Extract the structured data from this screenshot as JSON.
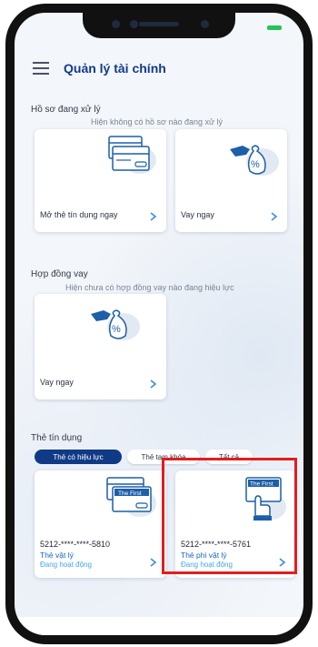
{
  "header": {
    "title": "Quản lý tài chính"
  },
  "profiles": {
    "title": "Hồ sơ đang xử lý",
    "note": "Hiện không có hồ sơ nào đang xử lý",
    "cards": [
      {
        "label": "Mở thẻ tín dụng ngay"
      },
      {
        "label": "Vay ngay"
      }
    ]
  },
  "loans": {
    "title": "Hợp đồng vay",
    "note": "Hiện chưa có hợp đồng vay nào đang hiệu lực",
    "cards": [
      {
        "label": "Vay ngay"
      }
    ]
  },
  "credit_cards": {
    "title": "Thẻ tín dụng",
    "filters": [
      "Thẻ có hiệu lực",
      "Thẻ tạm khóa",
      "Tất cả"
    ],
    "active_filter": "Thẻ có hiệu lực",
    "cards": [
      {
        "number": "5212-****-****-5810",
        "type": "Thẻ vật lý",
        "status": "Đang hoạt động",
        "brand": "The First"
      },
      {
        "number": "5212-****-****-5761",
        "type": "Thẻ phi vật lý",
        "status": "Đang hoạt động",
        "brand": "The First"
      }
    ]
  },
  "colors": {
    "brand": "#123a8a",
    "accent": "#1565c0",
    "status": "#42a5f5",
    "highlight": "#e01e1e"
  }
}
